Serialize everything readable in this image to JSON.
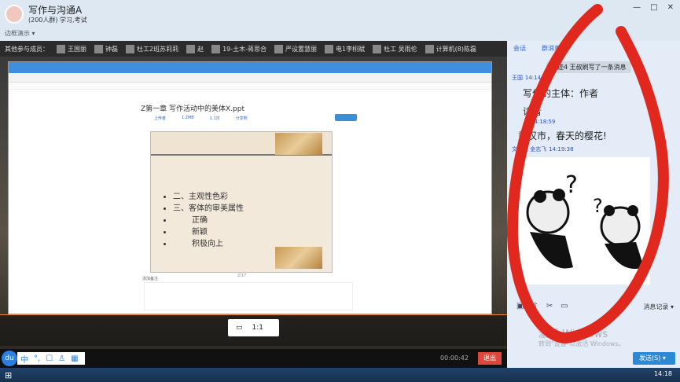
{
  "window": {
    "title": "写作与沟通A",
    "subtitle": "(200人群) 学习,考试",
    "mode": "边框演示 ▾",
    "controls": [
      "—",
      "□",
      "✕"
    ]
  },
  "members": {
    "label": "其他参与成员：",
    "items": [
      "王国丽",
      "钟磊",
      "杜工2班苏莉莉",
      "赵",
      "19-土木-蒋思合",
      "严设置慧丽",
      "电1李栩斌",
      "杜工 吴雨伦",
      "计算机(8)陈磊"
    ]
  },
  "document": {
    "title": "Z第一章 写作活动中的美体X.ppt",
    "links": [
      "上传者",
      "1.2MB",
      "1.1次",
      "分享到"
    ],
    "bullets": [
      "二、主观性色彩",
      "三、客体的审美属性",
      "正确",
      "新颖",
      "积极向上"
    ],
    "notes_label": "添加备注",
    "page": "2/17"
  },
  "viewer": {
    "ratio": "1:1"
  },
  "ime": {
    "logo": "du",
    "items": [
      "中",
      "°,",
      "☐",
      "♙",
      "▦"
    ]
  },
  "session": {
    "timer": "00:00:42",
    "quit": "退出"
  },
  "chat": {
    "tabs": [
      "会话",
      "群消息"
    ],
    "system": "文迹4 王叔刷写了一条消息",
    "messages": [
      {
        "name": "王国",
        "time": "14:14:36",
        "lines": [
          "写作的主体：作者",
          "读者"
        ]
      },
      {
        "name": "",
        "time": "14:18:59",
        "lines": [
          "武汉市，春天的樱花!"
        ]
      },
      {
        "name": "文迹映 金志飞",
        "time": "14:19:38",
        "lines": []
      }
    ],
    "history": "消息记录 ▾",
    "send": "发送(S) ▾",
    "watermark": "激活 Windows",
    "watermark_sub": "转到\"设置\"以激活 Windows。"
  },
  "taskbar": {
    "clock": "14:18",
    "start": "⊞"
  },
  "colors": {
    "ink": "#e0281e",
    "accent": "#2a8ad8"
  }
}
